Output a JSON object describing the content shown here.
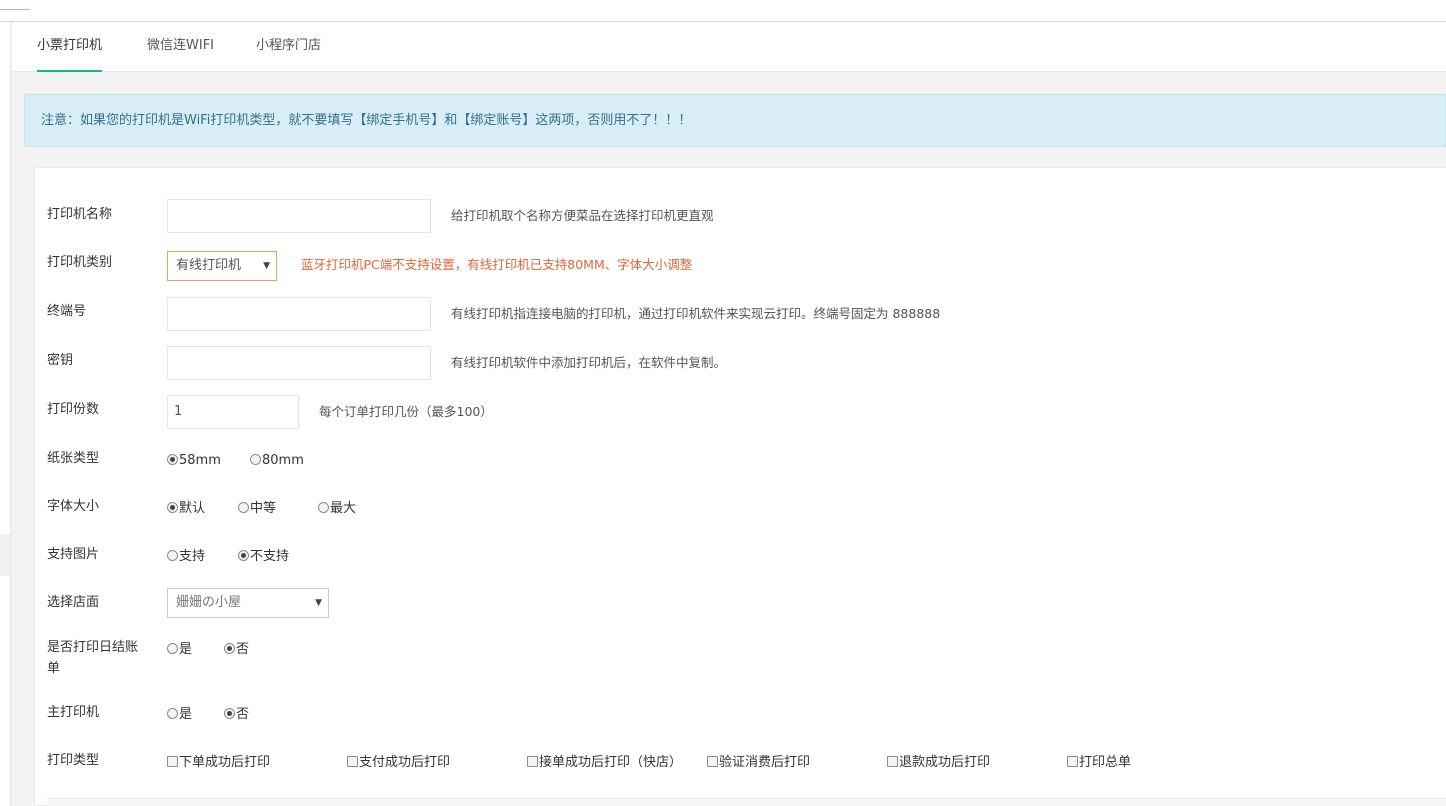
{
  "tabs": [
    "小票打印机",
    "微信连WIFI",
    "小程序门店"
  ],
  "notice": "注意：如果您的打印机是WiFi打印机类型，就不要填写【绑定手机号】和【绑定账号】这两项，否则用不了！！！",
  "form": {
    "name": {
      "label": "打印机名称",
      "value": "",
      "hint": "给打印机取个名称方便菜品在选择打印机更直观"
    },
    "type": {
      "label": "打印机类别",
      "selected": "有线打印机",
      "hint": "蓝牙打印机PC端不支持设置，有线打印机已支持80MM、字体大小调整"
    },
    "terminal": {
      "label": "终端号",
      "value": "",
      "hint": "有线打印机指连接电脑的打印机，通过打印机软件来实现云打印。终端号固定为 888888"
    },
    "secret": {
      "label": "密钥",
      "value": "",
      "hint": "有线打印机软件中添加打印机后，在软件中复制。"
    },
    "copies": {
      "label": "打印份数",
      "value": "1",
      "hint": "每个订单打印几份（最多100）"
    },
    "paper": {
      "label": "纸张类型",
      "options": [
        "58mm",
        "80mm"
      ],
      "checked": "58mm"
    },
    "font": {
      "label": "字体大小",
      "options": [
        "默认",
        "中等",
        "最大"
      ],
      "checked": "默认"
    },
    "image": {
      "label": "支持图片",
      "options": [
        "支持",
        "不支持"
      ],
      "checked": "不支持"
    },
    "store": {
      "label": "选择店面",
      "selected": "姗姗の小屋"
    },
    "daily": {
      "label_line1": "是否打印日结账",
      "label_line2": "单",
      "options": [
        "是",
        "否"
      ],
      "checked": "否"
    },
    "main": {
      "label": "主打印机",
      "options": [
        "是",
        "否"
      ],
      "checked": "否"
    },
    "print_types": {
      "label": "打印类型",
      "options": [
        "下单成功后打印",
        "支付成功后打印",
        "接单成功后打印（快店）",
        "验证消费后打印",
        "退款成功后打印",
        "打印总单"
      ]
    }
  },
  "colors": {
    "accent": "#1ab394",
    "notice_bg": "#d9edf7",
    "notice_text": "#31708f",
    "warning_text": "#e0663d"
  }
}
